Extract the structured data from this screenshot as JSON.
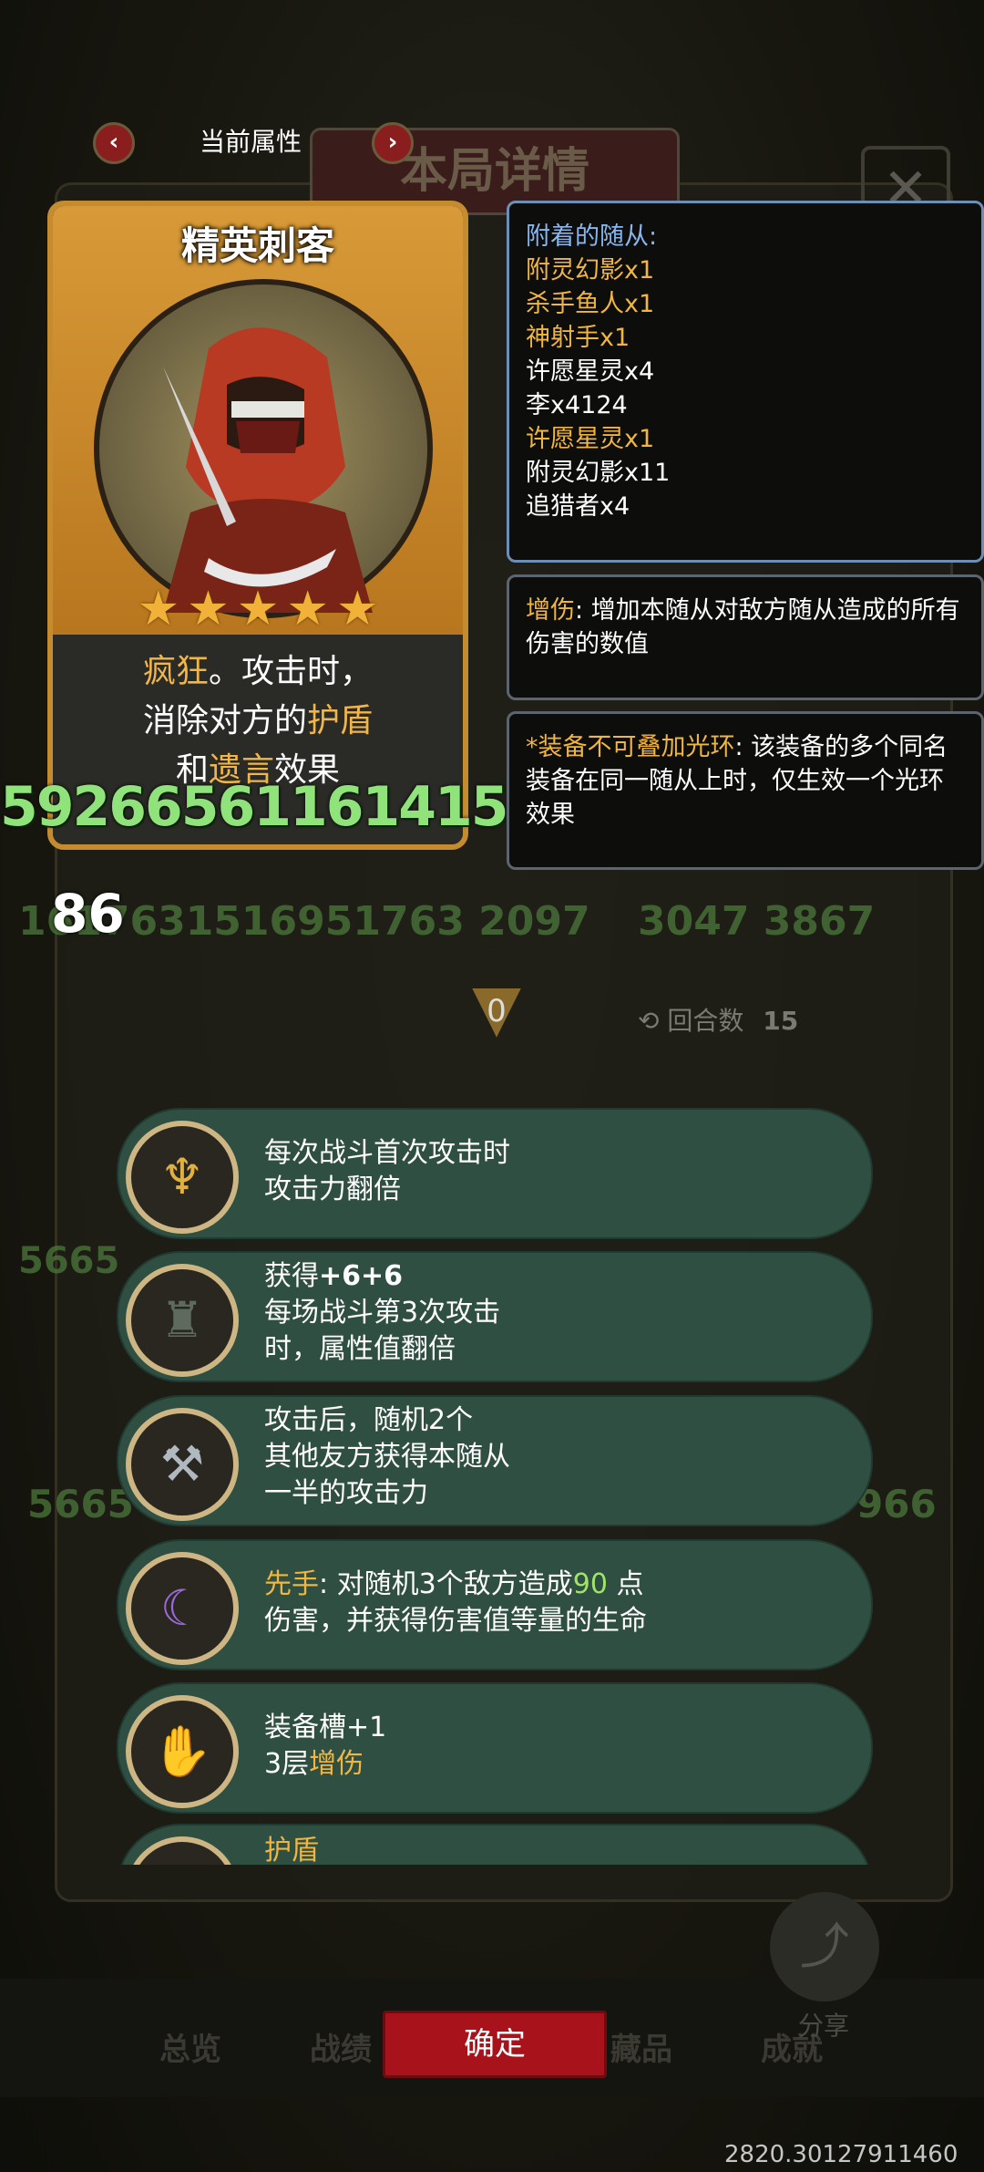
{
  "nav": {
    "title": "当前属性",
    "prev_icon": "chevron-left-icon",
    "next_icon": "chevron-right-icon"
  },
  "background": {
    "dialog_title": "本局详情",
    "close_symbol": "✕"
  },
  "card": {
    "name": "精英刺客",
    "stars": 5,
    "desc_line1_kw": "疯狂",
    "desc_line1_rest": "。攻击时，",
    "desc_line2_pre": "消除对方的",
    "desc_line2_kw": "护盾",
    "desc_line3_pre": "和",
    "desc_line3_kw": "遗言",
    "desc_line3_post": "效果"
  },
  "damage_text": "59266561161415",
  "level_badge": "86",
  "faded_numbers": {
    "row1": "1617631516951763 2097",
    "row1_right": "3047 3867",
    "row2": "5665",
    "row3": "5665",
    "row3_right": "966"
  },
  "attached_minions": {
    "title": "附着的随从:",
    "items": [
      {
        "text": "附灵幻影x1",
        "color": "gold"
      },
      {
        "text": "杀手鱼人x1",
        "color": "gold"
      },
      {
        "text": "神射手x1",
        "color": "gold"
      },
      {
        "text": "许愿星灵x4",
        "color": "white"
      },
      {
        "text": "李x4124",
        "color": "white"
      },
      {
        "text": "许愿星灵x1",
        "color": "gold"
      },
      {
        "text": "附灵幻影x11",
        "color": "white"
      },
      {
        "text": "追猎者x4",
        "color": "white"
      }
    ]
  },
  "keyword_panel_1": {
    "keyword": "增伤",
    "text": ": 增加本随从对敌方随从造成的所有伤害的数值"
  },
  "keyword_panel_2": {
    "keyword": "*装备不可叠加光环",
    "text": ": 该装备的多个同名装备在同一随从上时，仅生效一个光环效果"
  },
  "round": {
    "arrow_value": "0",
    "label": "回合数",
    "value": "15"
  },
  "skills": [
    {
      "icon": "golden-idol-icon",
      "line1": "每次战斗首次攻击时",
      "line2": "攻击力翻倍"
    },
    {
      "icon": "cloaked-figure-icon",
      "line1_pre": "获得",
      "line1_bold": "+6+6",
      "line2": "每场战斗第3次攻击",
      "line3": "时，属性值翻倍"
    },
    {
      "icon": "axe-icon",
      "line1": "攻击后，随机2个",
      "line2": "其他友方获得本随从",
      "line3": "一半的攻击力"
    },
    {
      "icon": "purple-scythe-icon",
      "kw": "先手",
      "line1": ": 对随机3个敌方造成",
      "num": "90",
      "line1_post": " 点",
      "line2": "伤害，并获得伤害值等量的生命"
    },
    {
      "icon": "gauntlet-icon",
      "line1": "装备槽+1",
      "line2_pre": "3层",
      "line2_kw": "增伤"
    },
    {
      "icon": "shield-burst-icon",
      "kw": "护盾"
    }
  ],
  "bottom": {
    "tabs": [
      "总览",
      "战绩",
      "藏品",
      "成就"
    ],
    "confirm": "确定",
    "share": "分享"
  },
  "coords": "2820.30127911460"
}
